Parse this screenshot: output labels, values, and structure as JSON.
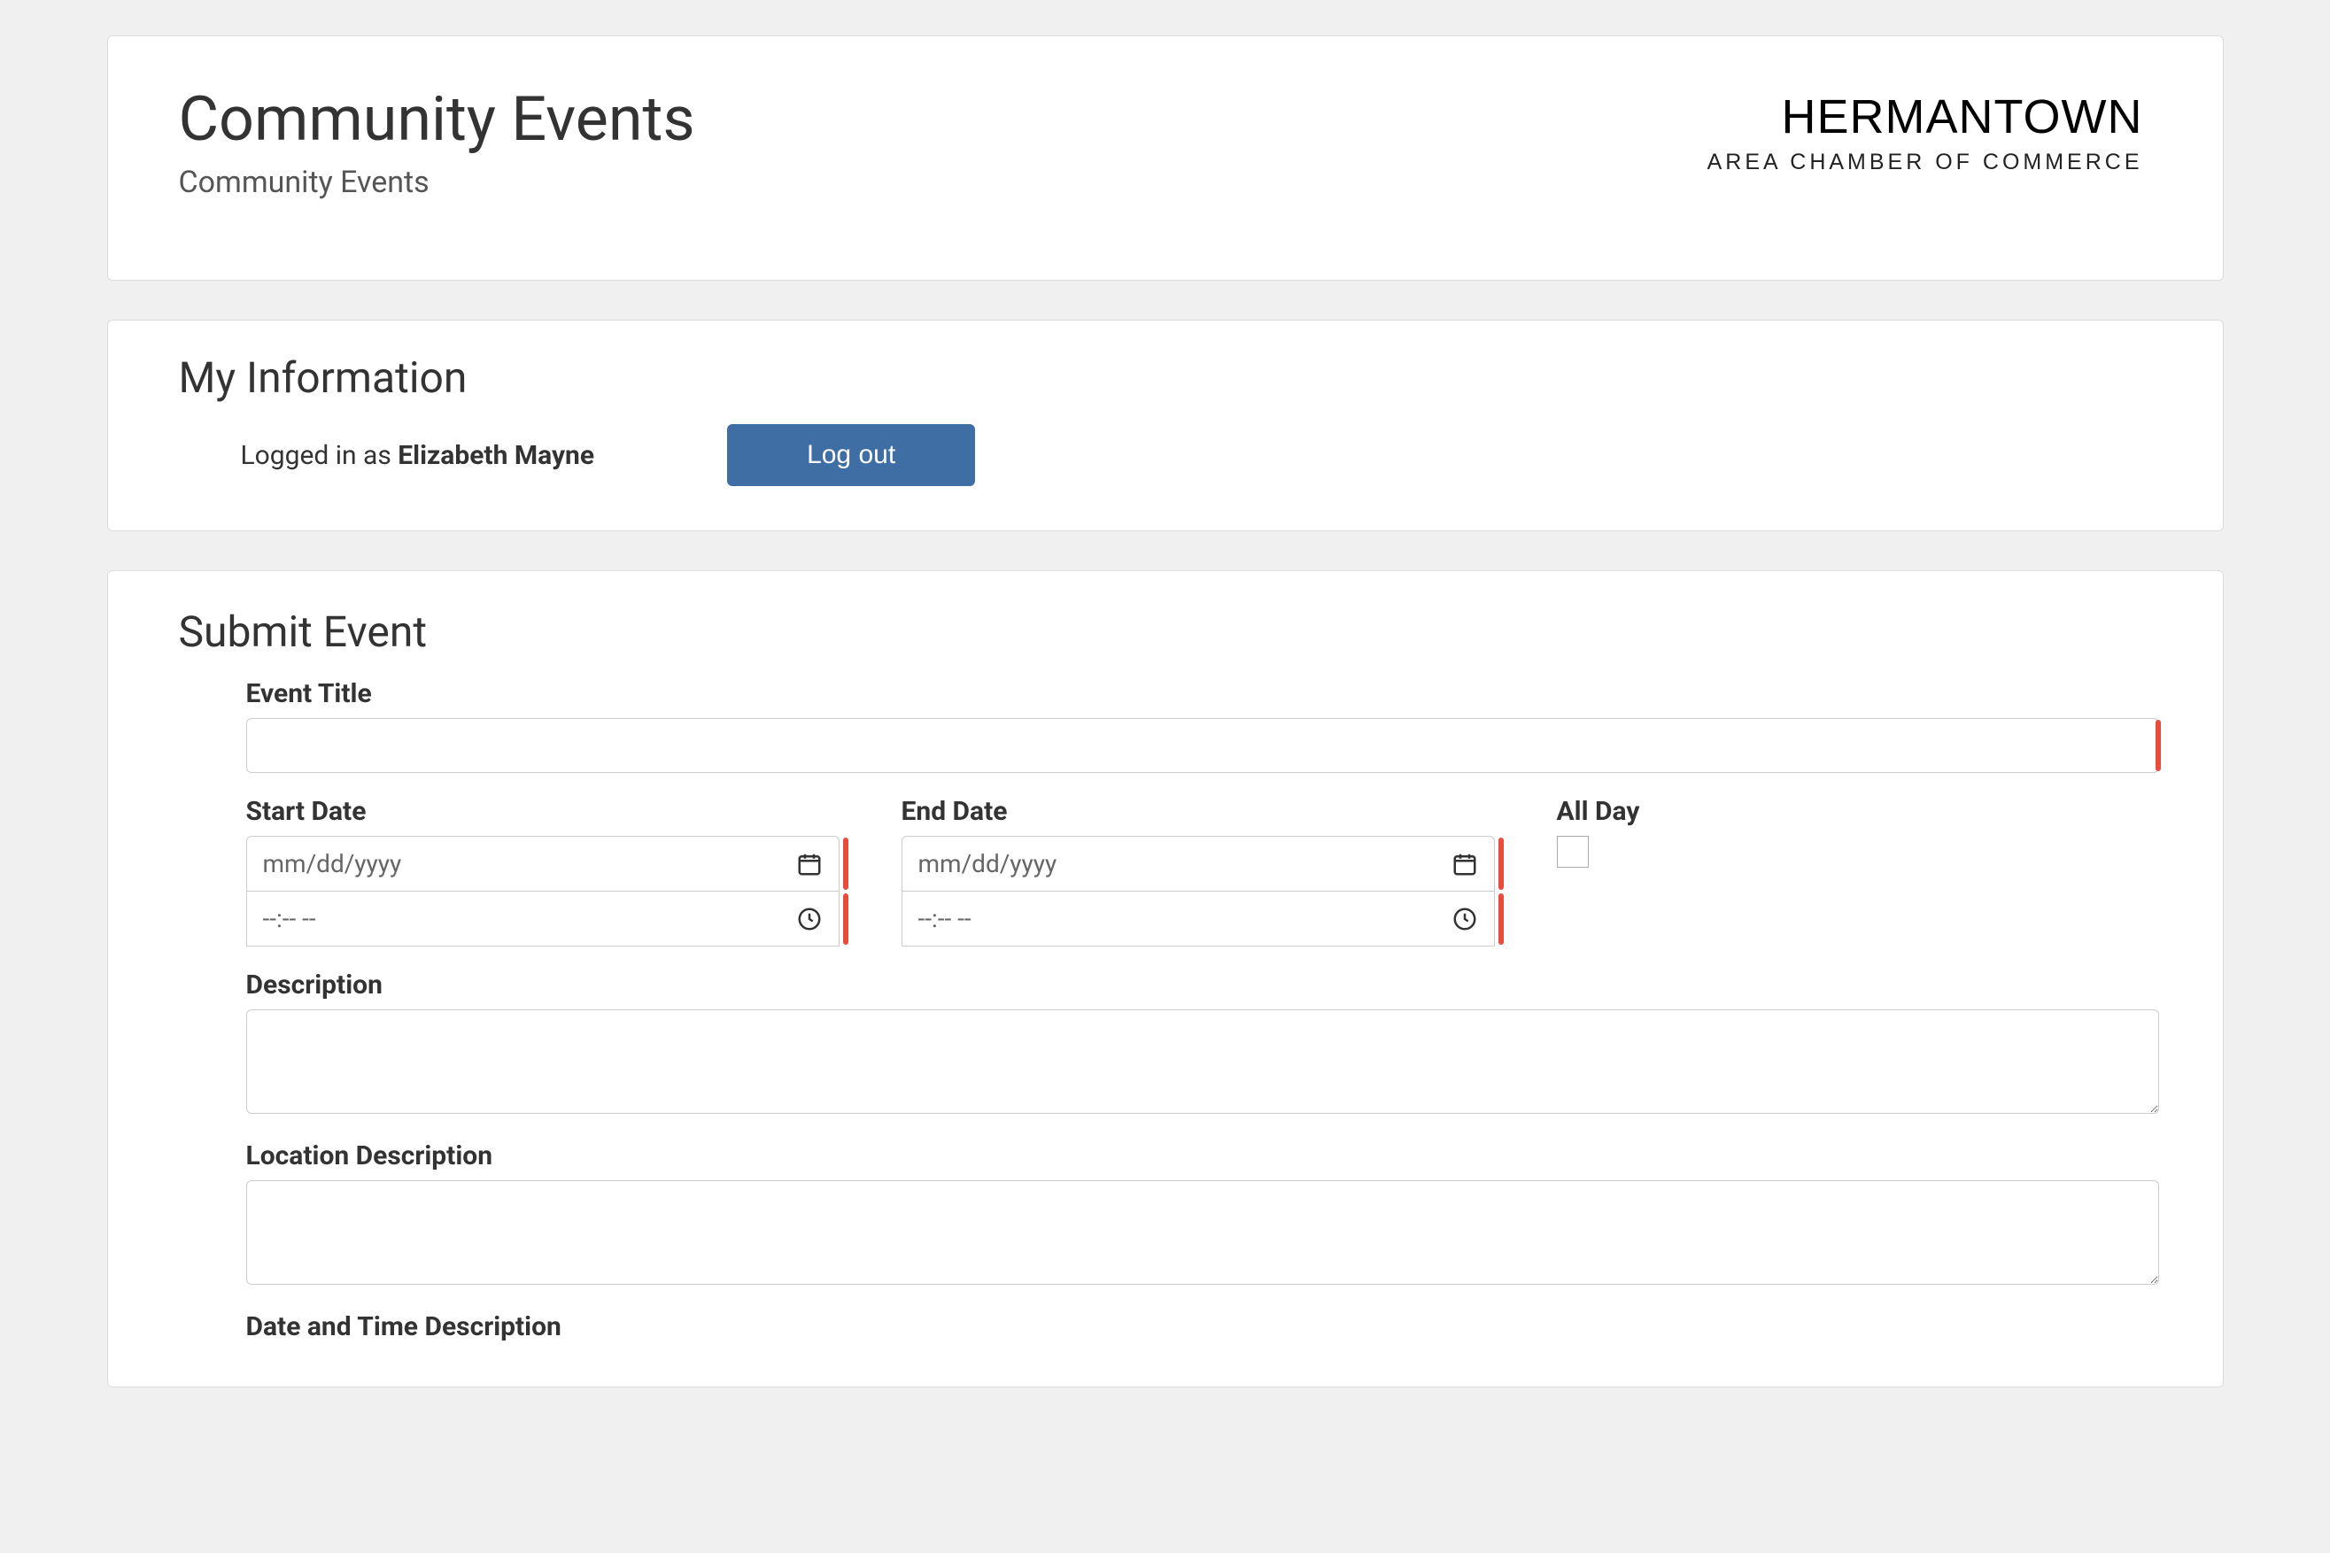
{
  "header": {
    "title": "Community Events",
    "subtitle": "Community Events",
    "logo_line1": "HERMANTOWN",
    "logo_line2": "AREA CHAMBER OF COMMERCE"
  },
  "info": {
    "section_title": "My Information",
    "logged_in_prefix": "Logged in as ",
    "user_name": "Elizabeth Mayne",
    "logout_label": "Log out"
  },
  "form": {
    "section_title": "Submit Event",
    "event_title_label": "Event Title",
    "event_title_value": "",
    "start_date_label": "Start Date",
    "end_date_label": "End Date",
    "all_day_label": "All Day",
    "date_placeholder": "mm/dd/yyyy",
    "time_placeholder": "--:-- --",
    "start_date_value": "",
    "start_time_value": "",
    "end_date_value": "",
    "end_time_value": "",
    "all_day_checked": false,
    "description_label": "Description",
    "description_value": "",
    "location_desc_label": "Location Description",
    "location_desc_value": "",
    "datetime_desc_label": "Date and Time Description"
  }
}
